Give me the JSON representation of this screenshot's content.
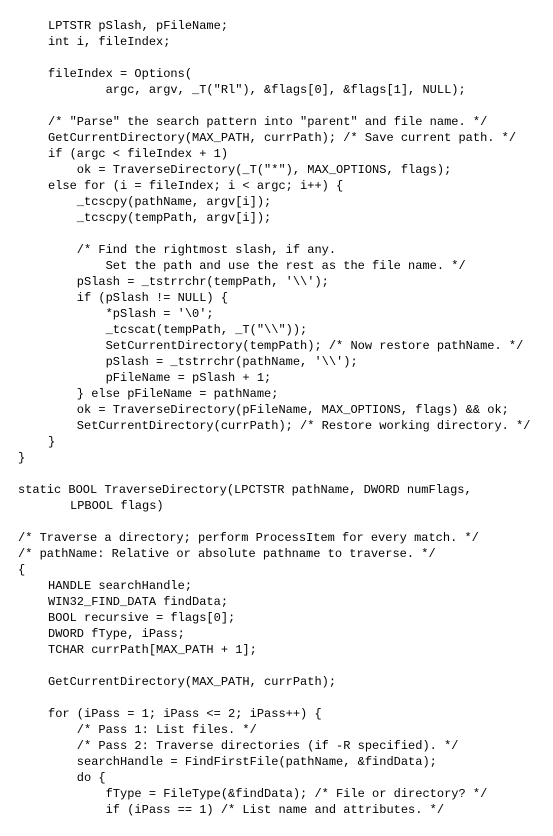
{
  "code": "LPTSTR pSlash, pFileName;\nint i, fileIndex;\n\nfileIndex = Options(\n        argc, argv, _T(\"Rl\"), &flags[0], &flags[1], NULL);\n\n/* \"Parse\" the search pattern into \"parent\" and file name. */\nGetCurrentDirectory(MAX_PATH, currPath); /* Save current path. */\nif (argc < fileIndex + 1)\n    ok = TraverseDirectory(_T(\"*\"), MAX_OPTIONS, flags);\nelse for (i = fileIndex; i < argc; i++) {\n    _tcscpy(pathName, argv[i]);\n    _tcscpy(tempPath, argv[i]);\n\n    /* Find the rightmost slash, if any.\n        Set the path and use the rest as the file name. */\n    pSlash = _tstrrchr(tempPath, '\\\\');\n    if (pSlash != NULL) {\n        *pSlash = '\\0';\n        _tcscat(tempPath, _T(\"\\\\\"));\n        SetCurrentDirectory(tempPath); /* Now restore pathName. */\n        pSlash = _tstrrchr(pathName, '\\\\');\n        pFileName = pSlash + 1;\n    } else pFileName = pathName;\n    ok = TraverseDirectory(pFileName, MAX_OPTIONS, flags) && ok;\n    SetCurrentDirectory(currPath); /* Restore working directory. */\n}",
  "closing_brace": "}",
  "func_sig_prefix": "static BOOL TraverseDirectory(LPCTSTR pathName, DWORD numFlags,",
  "func_sig_cont": "LPBOOL flags)",
  "comment1": "/* Traverse a directory; perform ProcessItem for every match. */",
  "comment2": "/* pathName: Relative or absolute pathname to traverse. */",
  "body": "HANDLE searchHandle;\nWIN32_FIND_DATA findData;\nBOOL recursive = flags[0];\nDWORD fType, iPass;\nTCHAR currPath[MAX_PATH + 1];\n\nGetCurrentDirectory(MAX_PATH, currPath);\n\nfor (iPass = 1; iPass <= 2; iPass++) {\n    /* Pass 1: List files. */\n    /* Pass 2: Traverse directories (if -R specified). */\n    searchHandle = FindFirstFile(pathName, &findData);\n    do {\n        fType = FileType(&findData); /* File or directory? */\n        if (iPass == 1) /* List name and attributes. */"
}
